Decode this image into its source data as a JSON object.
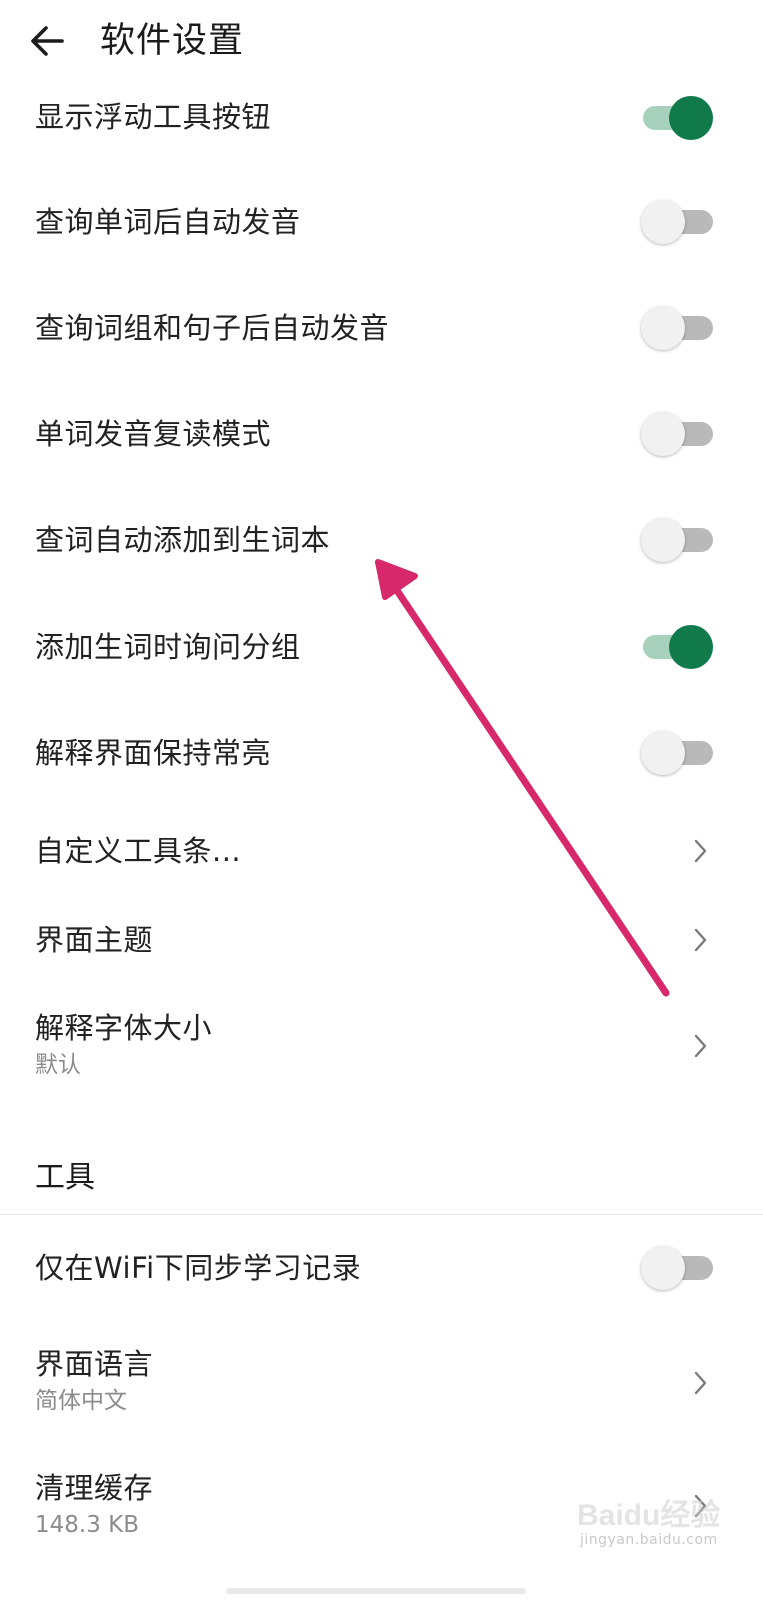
{
  "header": {
    "title": "软件设置",
    "back_icon": "arrow-left-icon"
  },
  "settings": [
    {
      "label": "显示浮动工具按钮",
      "control": "toggle",
      "on": true
    },
    {
      "label": "查询单词后自动发音",
      "control": "toggle",
      "on": false
    },
    {
      "label": "查询词组和句子后自动发音",
      "control": "toggle",
      "on": false
    },
    {
      "label": "单词发音复读模式",
      "control": "toggle",
      "on": false
    },
    {
      "label": "查词自动添加到生词本",
      "control": "toggle",
      "on": false
    },
    {
      "label": "添加生词时询问分组",
      "control": "toggle",
      "on": true
    },
    {
      "label": "解释界面保持常亮",
      "control": "toggle",
      "on": false
    },
    {
      "label": "自定义工具条...",
      "control": "chevron"
    },
    {
      "label": "界面主题",
      "control": "chevron"
    },
    {
      "label": "解释字体大小",
      "sublabel": "默认",
      "control": "chevron"
    }
  ],
  "tools_section": {
    "title": "工具",
    "items": [
      {
        "label": "仅在WiFi下同步学习记录",
        "control": "toggle",
        "on": false
      },
      {
        "label": "界面语言",
        "sublabel": "简体中文",
        "control": "chevron"
      },
      {
        "label": "清理缓存",
        "sublabel": "148.3 KB",
        "control": "chevron"
      }
    ]
  },
  "colors": {
    "toggle_on_thumb": "#107a4b",
    "toggle_on_track": "#a8d1bd",
    "toggle_off_thumb": "#f1f1f1",
    "toggle_off_track": "#b9b9b9",
    "annotation_arrow": "#d6286a"
  },
  "watermark": {
    "brand": "Baidu经验",
    "domain": "jingyan.baidu.com"
  }
}
